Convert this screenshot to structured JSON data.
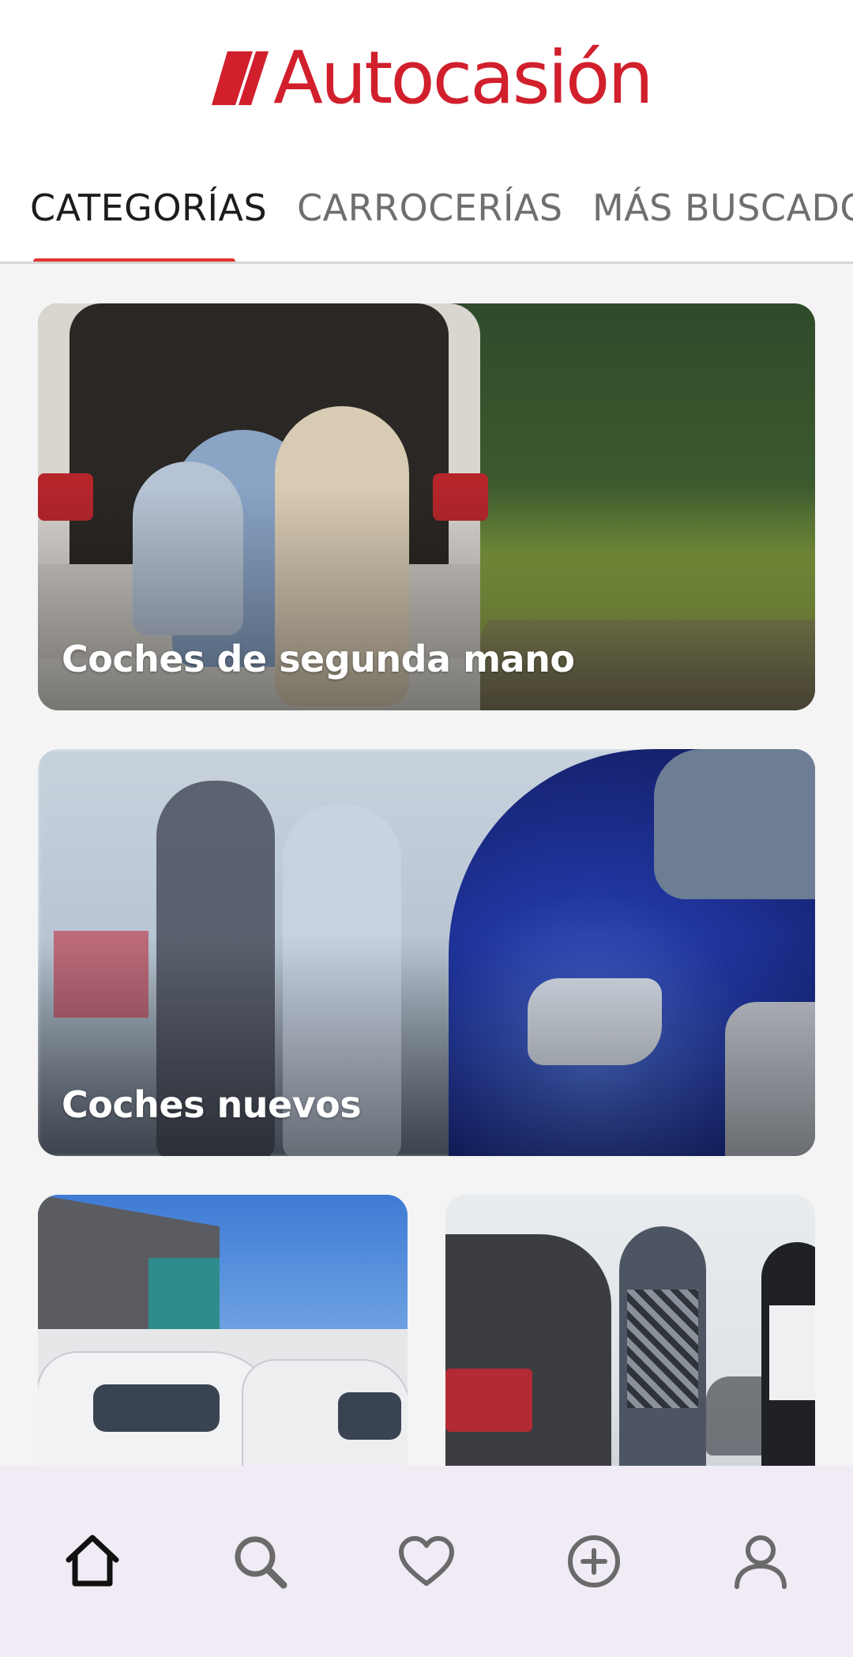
{
  "header": {
    "logo_text": "Autocasión",
    "brand_color": "#d11f2c"
  },
  "tabs": [
    {
      "label": "CATEGORÍAS",
      "active": true
    },
    {
      "label": "CARROCERÍAS",
      "active": false
    },
    {
      "label": "MÁS BUSCADOS",
      "active": false
    }
  ],
  "accent_color": "#e3342f",
  "cards": [
    {
      "label": "Coches de segunda mano",
      "icon": "family-car-photo"
    },
    {
      "label": "Coches nuevos",
      "icon": "couple-new-car-photo"
    },
    {
      "label": "",
      "icon": "vans-photo"
    },
    {
      "label": "",
      "icon": "showroom-handshake-photo"
    }
  ],
  "bottom_nav": [
    {
      "icon": "home-icon",
      "active": true
    },
    {
      "icon": "search-icon",
      "active": false
    },
    {
      "icon": "heart-icon",
      "active": false
    },
    {
      "icon": "add-circle-icon",
      "active": false
    },
    {
      "icon": "user-icon",
      "active": false
    }
  ]
}
